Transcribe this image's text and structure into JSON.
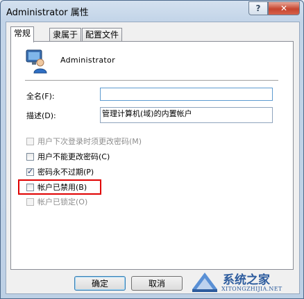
{
  "window": {
    "title": "Administrator 属性",
    "help_label": "?",
    "close_label": "✕"
  },
  "tabs": [
    {
      "label": "常规",
      "active": true
    },
    {
      "label": "隶属于",
      "active": false
    },
    {
      "label": "配置文件",
      "active": false
    }
  ],
  "user": {
    "name": "Administrator",
    "icon": "user-icon"
  },
  "fields": {
    "fullname_label": "全名(F):",
    "fullname_value": "",
    "description_label": "描述(D):",
    "description_value": "管理计算机(域)的内置帐户"
  },
  "checkboxes": [
    {
      "label": "用户下次登录时须更改密码(M)",
      "checked": false,
      "enabled": false
    },
    {
      "label": "用户不能更改密码(C)",
      "checked": false,
      "enabled": true
    },
    {
      "label": "密码永不过期(P)",
      "checked": true,
      "enabled": true
    },
    {
      "label": "帐户已禁用(B)",
      "checked": false,
      "enabled": true
    },
    {
      "label": "帐户已锁定(O)",
      "checked": false,
      "enabled": false
    }
  ],
  "buttons": {
    "ok_label": "确定",
    "cancel_label": "取消"
  },
  "watermark": {
    "title": "系统之家",
    "subtitle": "XITONGZHIJIA.NET"
  },
  "colors": {
    "highlight_border": "#e00000",
    "close_button": "#c6452f",
    "check_mark": "#1f3b73"
  }
}
